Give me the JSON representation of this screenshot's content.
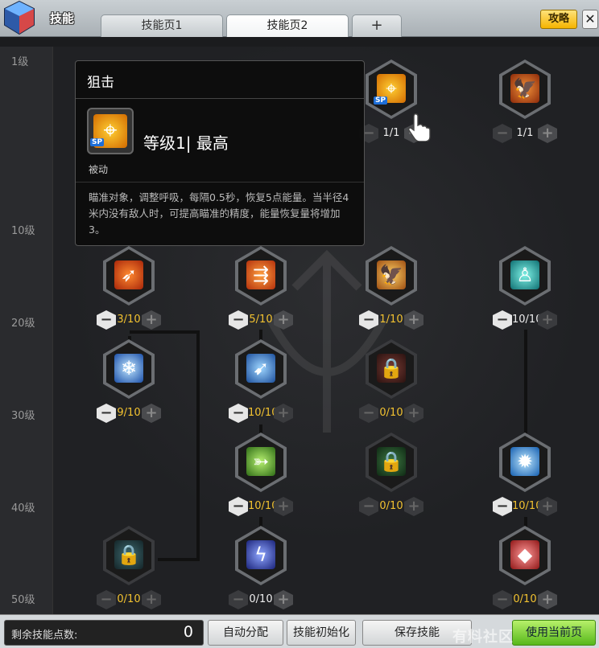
{
  "window": {
    "title": "技能",
    "help_label": "攻略",
    "close_label": "✕"
  },
  "tabs": [
    {
      "label": "技能页1",
      "active": false
    },
    {
      "label": "技能页2",
      "active": true
    },
    {
      "label": "+",
      "active": false
    }
  ],
  "levels": [
    "1级",
    "10级",
    "20级",
    "30级",
    "40级",
    "50级"
  ],
  "skills": [
    {
      "id": "s-top-3",
      "icon": "crosshair-icon",
      "level": "1/1",
      "sp": true,
      "color": "#e48a10"
    },
    {
      "id": "s-top-4",
      "icon": "eagle-icon",
      "level": "1/1",
      "sp": false,
      "color": "#b84b12"
    },
    {
      "id": "s-r1-1",
      "icon": "arrow-burst-icon",
      "level": "3/10",
      "color": "#d14a12"
    },
    {
      "id": "s-r1-2",
      "icon": "triple-arrow-icon",
      "level": "5/10",
      "color": "#d6581a"
    },
    {
      "id": "s-r1-3",
      "icon": "eagle-strike-icon",
      "level": "1/10",
      "color": "#c5701d"
    },
    {
      "id": "s-r1-4",
      "icon": "spirit-figure-icon",
      "level": "10/10",
      "color": "#1ba5a0"
    },
    {
      "id": "s-r2-1",
      "icon": "ice-arrow-icon",
      "level": "9/10",
      "color": "#2a78d0"
    },
    {
      "id": "s-r2-2",
      "icon": "blue-arrows-icon",
      "level": "10/10",
      "color": "#2d6cc4"
    },
    {
      "id": "s-r2-3",
      "icon": "lock-icon",
      "level": "0/10",
      "color": "#5a2a26"
    },
    {
      "id": "s-r3-2",
      "icon": "green-bow-icon",
      "level": "10/10",
      "color": "#4d9a2c"
    },
    {
      "id": "s-r3-3",
      "icon": "lock-icon",
      "level": "0/10",
      "color": "#244a2a"
    },
    {
      "id": "s-r3-4",
      "icon": "gear-aura-icon",
      "level": "10/10",
      "color": "#1f7bd0"
    },
    {
      "id": "s-r4-1",
      "icon": "lock-icon",
      "level": "0/10",
      "color": "#2f4a50"
    },
    {
      "id": "s-r4-2",
      "icon": "lightning-bow-icon",
      "level": "0/10",
      "color": "#2a3fa8"
    },
    {
      "id": "s-r4-4",
      "icon": "red-gem-icon",
      "level": "0/10",
      "color": "#c23a38"
    }
  ],
  "tooltip": {
    "name": "狙击",
    "level_text": "等级1| 最高",
    "type": "被动",
    "sp_tag": "SP",
    "description": "瞄准对象，调整呼吸，每隔0.5秒，恢复5点能量。当半径4米内没有敌人时，可提高瞄准的精度，能量恢复量将增加3。"
  },
  "bottom": {
    "remaining_label": "剩余技能点数:",
    "remaining_value": "0",
    "auto_label": "自动分配",
    "reset_label": "技能初始化",
    "save_label": "保存技能",
    "apply_label": "使用当前页"
  },
  "watermark": "有料社区"
}
